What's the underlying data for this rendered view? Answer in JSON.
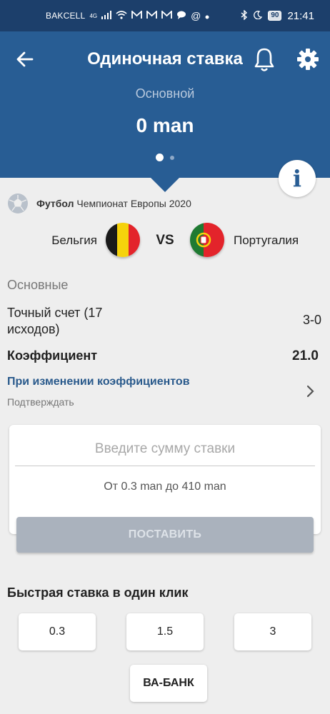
{
  "status_bar": {
    "carrier": "BAKCELL",
    "network": "4G",
    "battery": "90",
    "time": "21:41"
  },
  "header": {
    "title": "Одиночная ставка",
    "mode_label": "Основной",
    "balance": "0 man"
  },
  "info_button": {
    "label": "i"
  },
  "event": {
    "sport": "Футбол",
    "tournament": "Чемпионат Европы 2020",
    "team_home": "Бельгия",
    "team_away": "Португалия",
    "vs": "VS"
  },
  "bet": {
    "section_label": "Основные",
    "market_name": "Точный счет (17 исходов)",
    "market_value": "3-0",
    "coef_label": "Коэффициент",
    "coef_value": "21.0",
    "change_title": "При изменении коэффициентов",
    "change_value": "Подтверждать"
  },
  "amount": {
    "placeholder": "Введите сумму ставки",
    "value": "",
    "range_hint": "От 0.3 man до 410 man",
    "place_button": "ПОСТАВИТЬ"
  },
  "quick_bet": {
    "title": "Быстрая ставка в один клик",
    "amounts": [
      "0.3",
      "1.5",
      "3"
    ],
    "all_in": "ВА-БАНК"
  },
  "colors": {
    "header_bg": "#285d94",
    "status_bg": "#1c3f6b",
    "link": "#2a5a8c",
    "disabled_button": "#aab2bd"
  }
}
